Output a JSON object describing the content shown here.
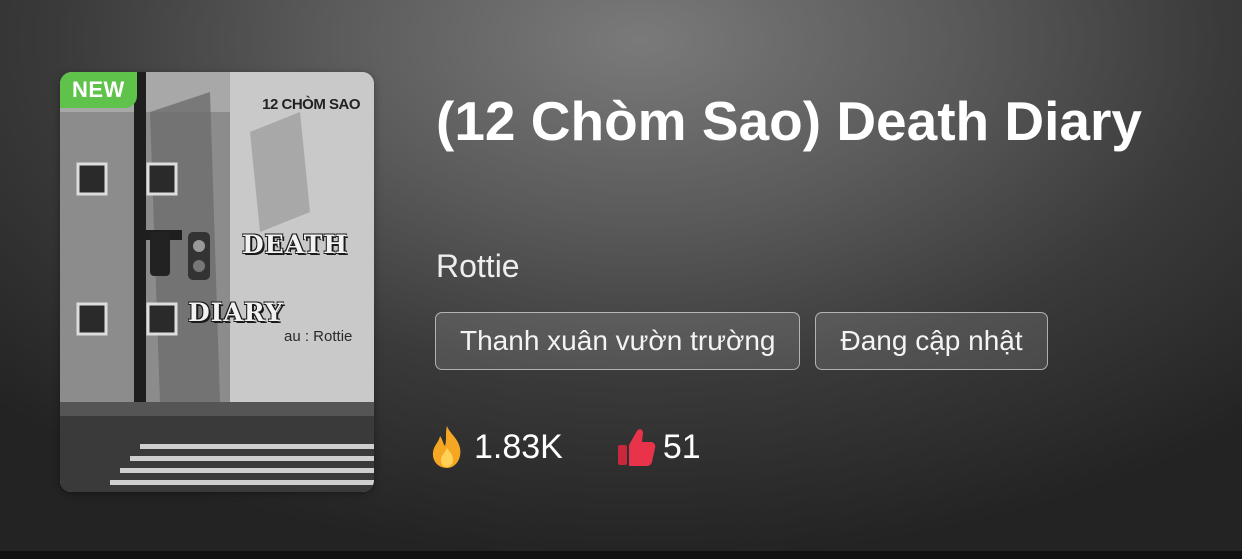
{
  "cover": {
    "badge": "NEW",
    "series": "12 CHÒM SAO",
    "title_line1": "DEATH",
    "title_line2": "DIARY",
    "author_line": "au : Rottie"
  },
  "story": {
    "title": "(12 Chòm Sao) Death Diary",
    "author": "Rottie",
    "tags": [
      "Thanh xuân vườn trường",
      "Đang cập nhật"
    ]
  },
  "stats": {
    "views": "1.83K",
    "likes": "51",
    "views_icon": "fire-icon",
    "likes_icon": "thumbs-up-icon"
  },
  "colors": {
    "badge_green": "#5fc24a",
    "fire": "#f5a623",
    "like_red": "#e8334a"
  }
}
